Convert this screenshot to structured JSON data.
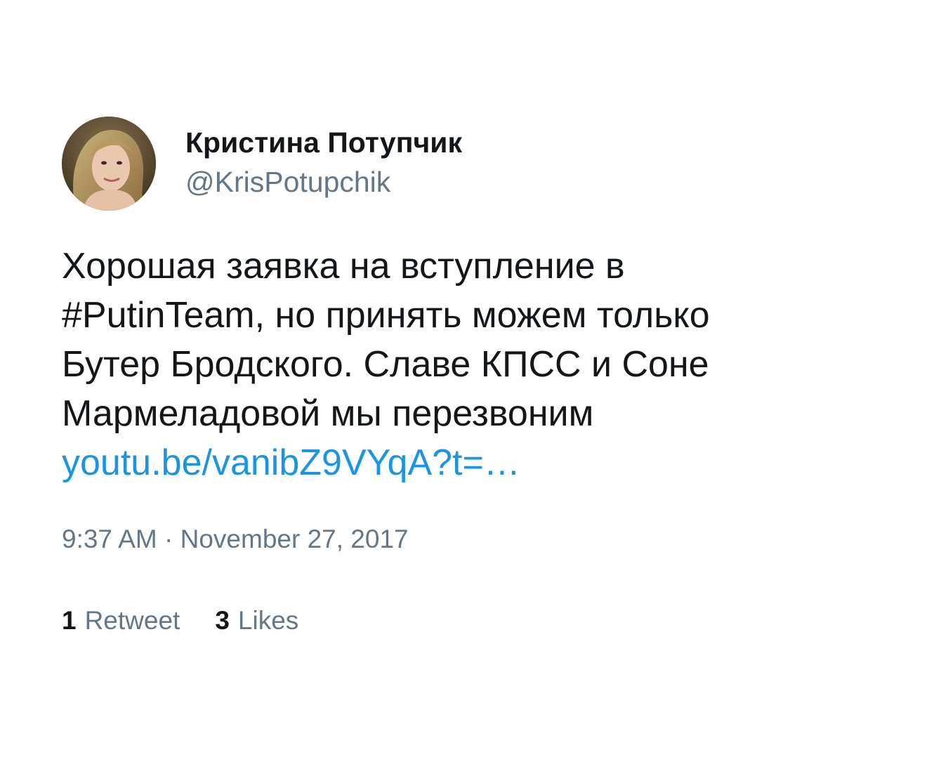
{
  "colors": {
    "text": "#14171a",
    "muted": "#657786",
    "link": "#1b95e0"
  },
  "user": {
    "display_name": "Кристина Потупчик",
    "handle": "@KrisPotupchik",
    "avatar_icon": "profile-photo"
  },
  "tweet": {
    "lines": [
      "Хорошая заявка на вступление в",
      "#PutinTeam, но принять можем только",
      "Бутер Бродского. Славе КПСС и Соне",
      "Мармеладовой мы перезвоним"
    ],
    "link": "youtu.be/vanibZ9VYqA?t=…",
    "timestamp": "9:37 AM · November 27, 2017"
  },
  "stats": {
    "retweets_count": "1",
    "retweets_label": "Retweet",
    "likes_count": "3",
    "likes_label": "Likes"
  }
}
